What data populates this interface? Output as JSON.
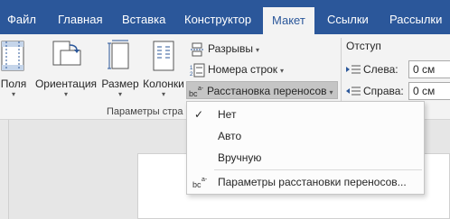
{
  "tabs": [
    {
      "label": "Файл"
    },
    {
      "label": "Главная"
    },
    {
      "label": "Вставка"
    },
    {
      "label": "Конструктор"
    },
    {
      "label": "Макет",
      "active": true
    },
    {
      "label": "Ссылки"
    },
    {
      "label": "Рассылки"
    }
  ],
  "ribbon": {
    "page_setup": {
      "fields_label": "Поля",
      "orientation_label": "Ориентация",
      "size_label": "Размер",
      "columns_label": "Колонки",
      "breaks_label": "Разрывы",
      "line_numbers_label": "Номера строк",
      "hyphenation_label": "Расстановка переносов",
      "group_label": "Параметры стра"
    },
    "indent": {
      "title": "Отступ",
      "left_label": "Слева:",
      "left_value": "0 см",
      "right_label": "Справа:",
      "right_value": "0 см"
    }
  },
  "hyphenation_menu": {
    "items": [
      {
        "label": "Нет",
        "checked": true
      },
      {
        "label": "Авто"
      },
      {
        "label": "Вручную"
      },
      {
        "label": "Параметры расстановки переносов..."
      }
    ]
  },
  "colors": {
    "tab_bar": "#2b579a",
    "ribbon_bg": "#f3f3f3",
    "accent_blue": "#2b579a"
  }
}
